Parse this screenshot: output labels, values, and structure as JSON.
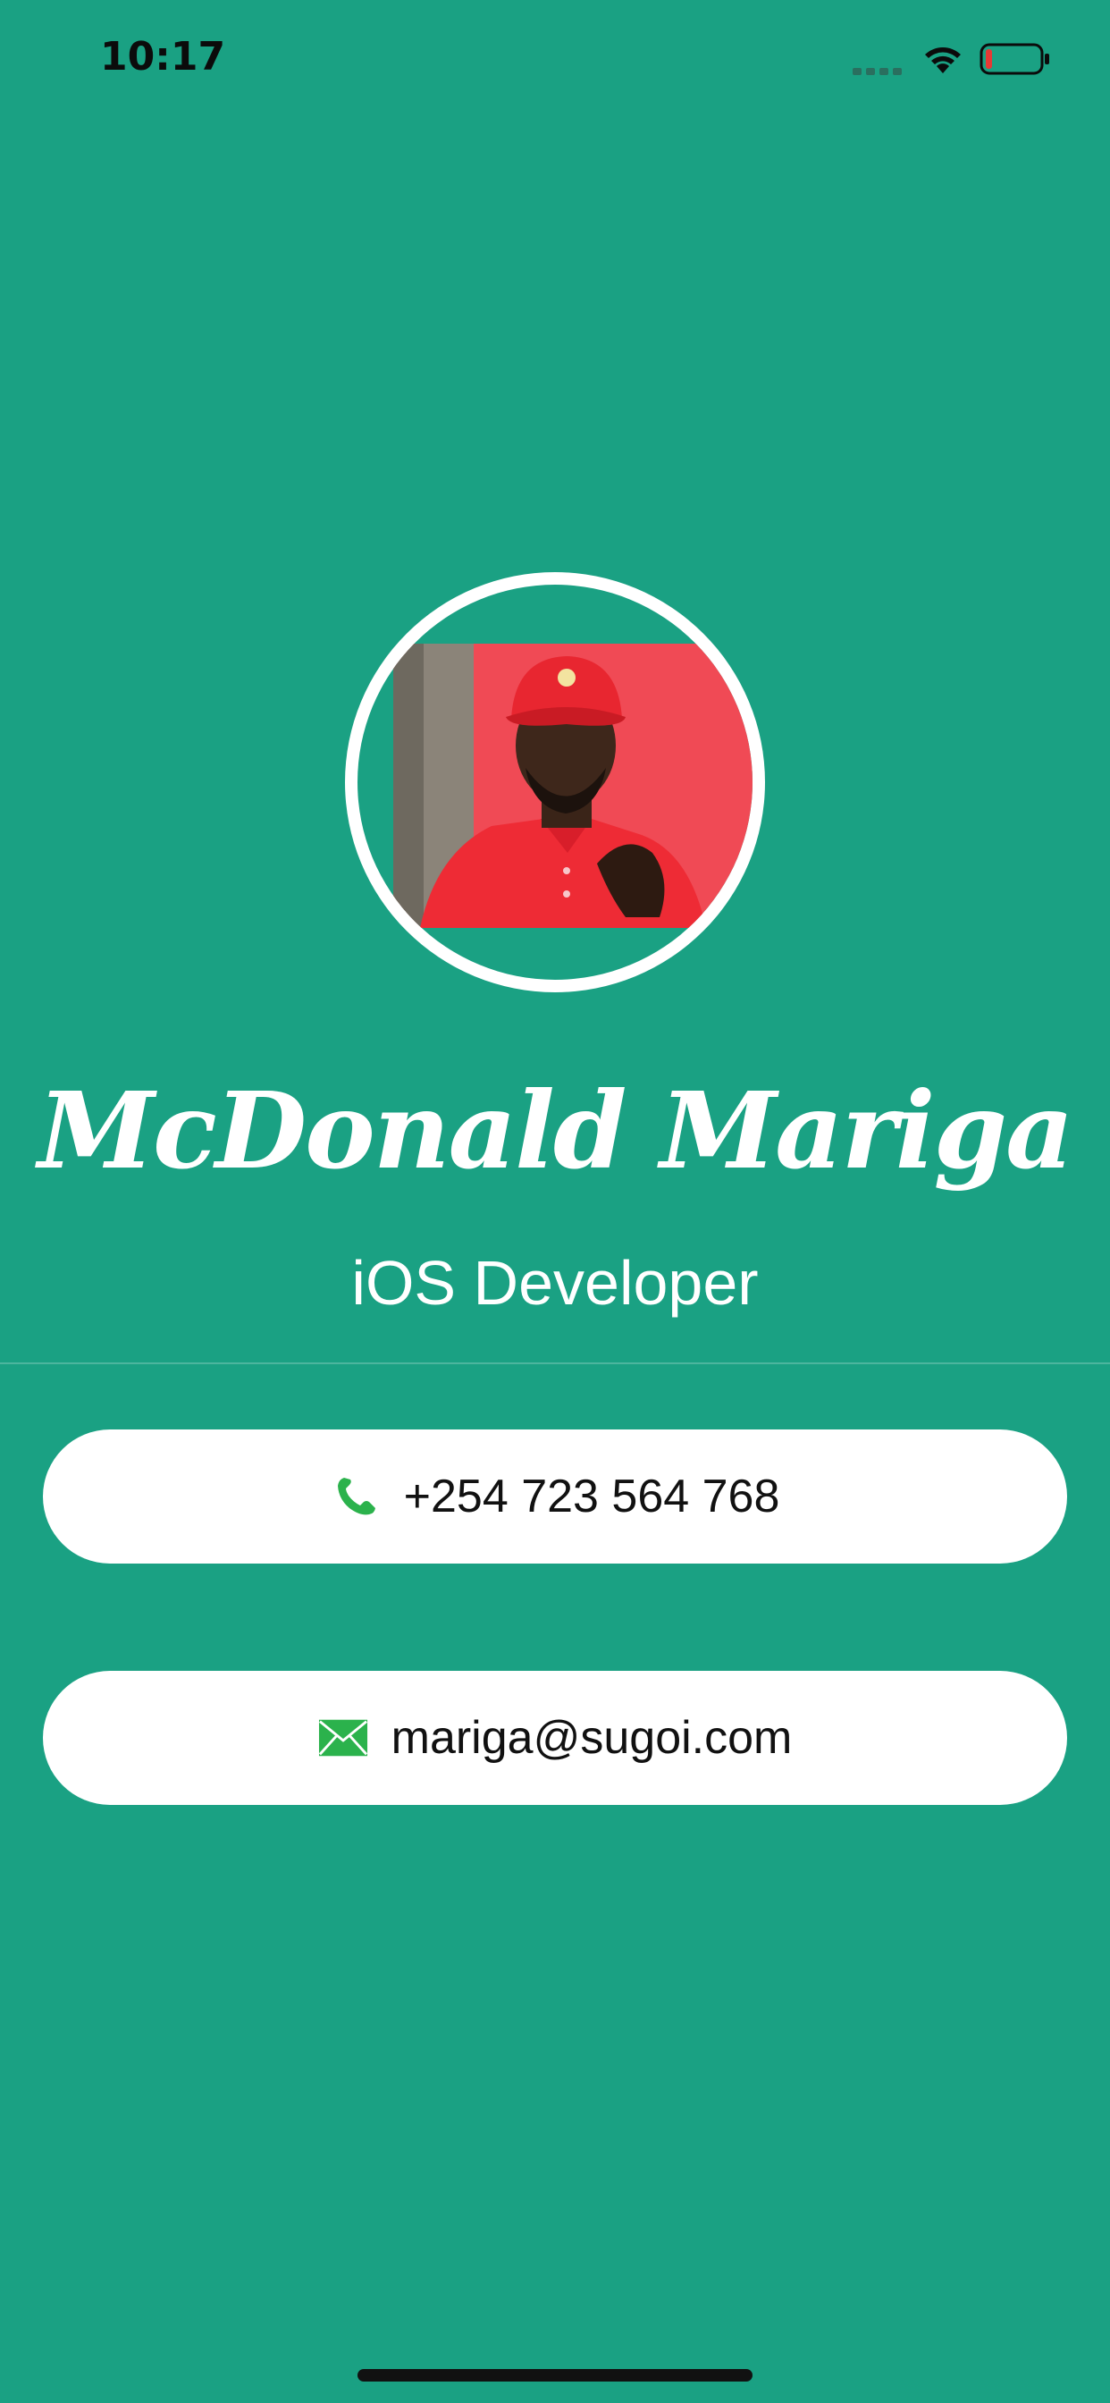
{
  "status_bar": {
    "time": "10:17"
  },
  "profile": {
    "name": "McDonald Mariga",
    "title": "iOS Developer"
  },
  "contacts": {
    "phone": "+254 723 564 768",
    "email": "mariga@sugoi.com"
  },
  "colors": {
    "background": "#1aa183",
    "card": "#ffffff",
    "icon_green": "#2bb24c",
    "battery_low": "#e53935"
  },
  "icons": {
    "phone": "phone-icon",
    "email": "envelope-icon",
    "wifi": "wifi-icon",
    "signal": "cellular-signal-icon",
    "battery": "battery-icon"
  }
}
